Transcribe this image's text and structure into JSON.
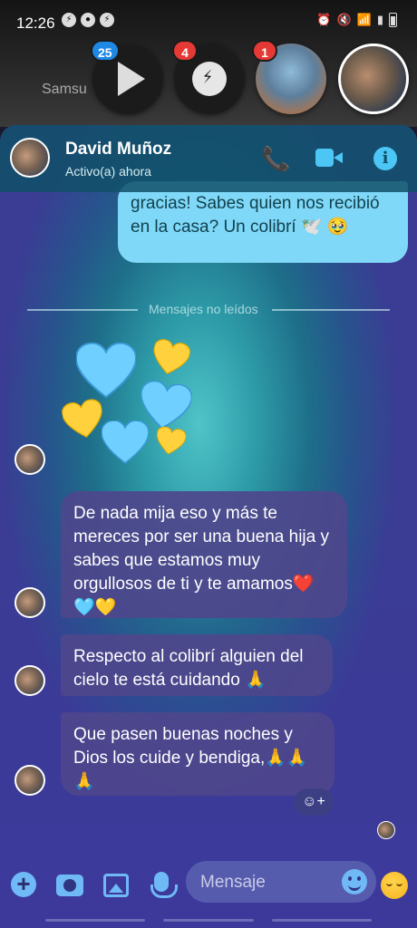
{
  "status_bar": {
    "time": "12:26",
    "left_icons": [
      "messenger-icon",
      "app-icon",
      "messenger-icon"
    ],
    "right_icons": [
      "alarm-icon",
      "mute-icon",
      "wifi-icon",
      "signal-icon",
      "battery-icon"
    ]
  },
  "launcher": {
    "label": "Samsu"
  },
  "chat_heads": [
    {
      "name": "play-app",
      "badge": "25",
      "badge_color": "#1e88e5"
    },
    {
      "name": "messenger-app",
      "badge": "4",
      "badge_color": "#e53935"
    },
    {
      "name": "contact-photo-1",
      "badge": "1",
      "badge_color": "#e53935"
    },
    {
      "name": "contact-photo-2",
      "badge": ""
    }
  ],
  "header": {
    "name": "David Muñoz",
    "status": "Activo(a) ahora",
    "accent": "#4cc6f5"
  },
  "messages": {
    "outgoing_1": "gracias! Sabes quien nos recibió en la casa? Un colibrí 🕊️ 🥹",
    "unread_divider": "Mensajes no leídos",
    "incoming_1": "De nada mija eso y más te mereces por ser una buena hija y sabes que estamos muy orgullosos de ti y te amamos❤️🩵💛",
    "incoming_2": "Respecto al colibrí alguien del cielo te está cuidando 🙏",
    "incoming_3": "Que pasen buenas noches y Dios los cuide y bendiga,🙏🙏🙏"
  },
  "hearts": [
    "light-blue-heart",
    "yellow-heart",
    "light-blue-heart",
    "yellow-heart",
    "light-blue-heart",
    "yellow-heart"
  ],
  "composer": {
    "placeholder": "Mensaje"
  }
}
